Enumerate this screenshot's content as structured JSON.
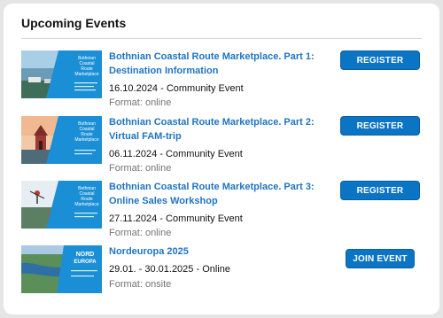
{
  "panel": {
    "title": "Upcoming Events"
  },
  "events": [
    {
      "title_line1": "Bothnian Coastal Route Marketplace. Part 1:",
      "title_line2": "Destination Information",
      "date_type": "16.10.2024 - Community Event",
      "format": "Format: online",
      "button": "REGISTER",
      "thumb_text": [
        "Bothnian",
        "Coastal",
        "Route",
        "Marketplace"
      ]
    },
    {
      "title_line1": "Bothnian Coastal Route Marketplace. Part 2:",
      "title_line2": "Virtual FAM-trip",
      "date_type": "06.11.2024 - Community Event",
      "format": "Format: online",
      "button": "REGISTER",
      "thumb_text": [
        "Bothnian",
        "Coastal",
        "Route",
        "Marketplace"
      ]
    },
    {
      "title_line1": "Bothnian Coastal Route Marketplace. Part 3:",
      "title_line2": "Online Sales Workshop",
      "date_type": "27.11.2024 - Community Event",
      "format": "Format: online",
      "button": "REGISTER",
      "thumb_text": [
        "Bothnian",
        "Coastal",
        "Route",
        "Marketplace"
      ]
    },
    {
      "title_line1": "Nordeuropa 2025",
      "title_line2": "",
      "date_type": "29.01. - 30.01.2025 - Online",
      "format": "Format: onsite",
      "button": "JOIN EVENT",
      "thumb_text": [
        "NORD",
        "EUROPA"
      ]
    }
  ],
  "colors": {
    "accent": "#0b74c4",
    "link": "#1f74c4",
    "thumb_blue": "#1b8fd6"
  }
}
